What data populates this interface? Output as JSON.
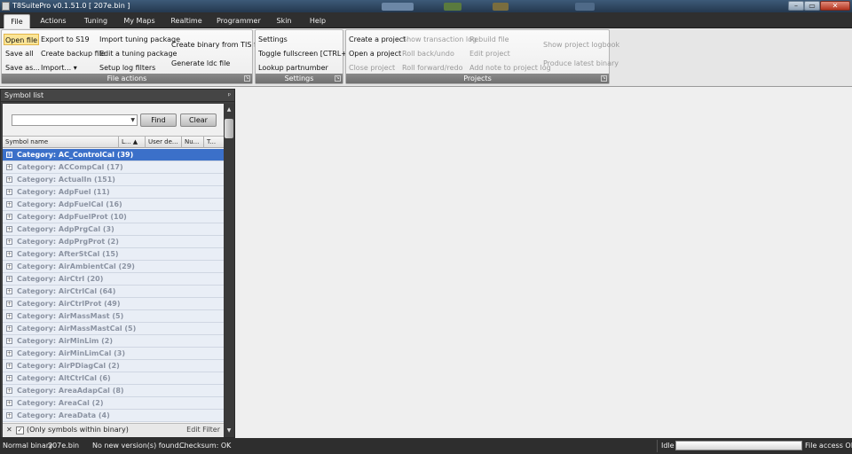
{
  "window": {
    "title": "T8SuitePro v0.1.51.0 [ 207e.bin ]",
    "controls": [
      "–",
      "▭",
      "✕"
    ]
  },
  "menu": {
    "tabs": [
      "File",
      "Actions",
      "Tuning",
      "My Maps",
      "Realtime",
      "Programmer",
      "Skin",
      "Help"
    ],
    "active": "File"
  },
  "ribbon": {
    "file_actions": {
      "title": "File actions",
      "items": [
        "Open file",
        "Save all",
        "Save as...",
        "Export to S19",
        "Create backup file",
        "Import...",
        "Import tuning package",
        "Edit a tuning package",
        "Setup log filters",
        "Create binary from TIS file",
        "Generate ldc file"
      ]
    },
    "settings": {
      "title": "Settings",
      "items": [
        "Settings",
        "Toggle fullscreen [CTRL+F]",
        "Lookup partnumber"
      ]
    },
    "projects": {
      "title": "Projects",
      "items": [
        "Create a project",
        "Open a project",
        "Close project",
        "Show transaction log",
        "Roll back/undo",
        "Roll forward/redo",
        "Rebuild file",
        "Edit project",
        "Add note to project log",
        "Show project logbook",
        "Produce latest binary"
      ]
    }
  },
  "symbol_panel": {
    "title": "Symbol list",
    "pin": "ᵖ",
    "search_value": "",
    "find_label": "Find",
    "clear_label": "Clear",
    "columns": [
      "Symbol name",
      "L... ▲",
      "User de...",
      "Nu...",
      "T..."
    ],
    "rows": [
      "Category: AC_ControlCal  (39)",
      "Category: ACCompCal  (17)",
      "Category: ActualIn  (151)",
      "Category: AdpFuel  (11)",
      "Category: AdpFuelCal  (16)",
      "Category: AdpFuelProt  (10)",
      "Category: AdpPrgCal  (3)",
      "Category: AdpPrgProt  (2)",
      "Category: AfterStCal  (15)",
      "Category: AirAmbientCal  (29)",
      "Category: AirCtrl  (20)",
      "Category: AirCtrlCal  (64)",
      "Category: AirCtrlProt  (49)",
      "Category: AirMassMast  (5)",
      "Category: AirMassMastCal  (5)",
      "Category: AirMinLim  (2)",
      "Category: AirMinLimCal  (3)",
      "Category: AirPDiagCal  (2)",
      "Category: AltCtrlCal  (6)",
      "Category: AreaAdapCal  (8)",
      "Category: AreaCal  (2)",
      "Category: AreaData  (4)"
    ],
    "selected_row": "Category: AC_ControlCal  (39)",
    "filter": {
      "close": "✕",
      "checked": "✓",
      "label": "(Only symbols within binary)",
      "edit": "Edit Filter"
    }
  },
  "status": {
    "binary_label": "Normal binary",
    "binary_file": "207e.bin",
    "version_msg": "No new version(s) found...",
    "checksum": "Checksum: OK",
    "state": "Idle",
    "file_access": "File access OK"
  }
}
